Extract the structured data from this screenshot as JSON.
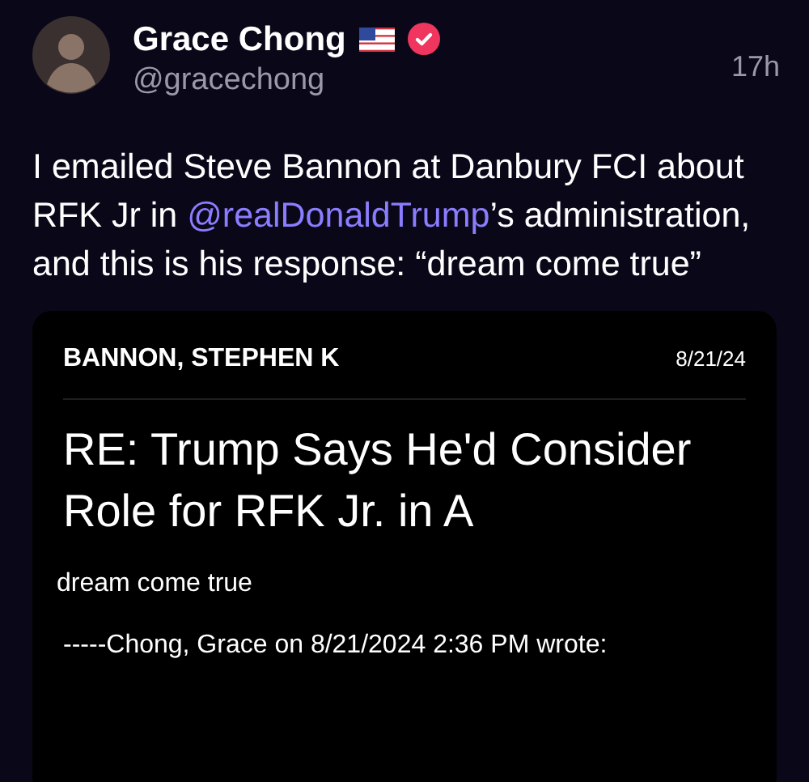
{
  "post": {
    "author": {
      "name": "Grace Chong",
      "handle": "@gracechong",
      "verified": true
    },
    "time": "17h",
    "text_before": "I emailed Steve Bannon at Danbury FCI about RFK Jr in ",
    "mention": "@realDonaldTrump",
    "text_after": "’s administration, and this is his response: “dream come true”",
    "email": {
      "sender": "BANNON, STEPHEN K",
      "date": "8/21/24",
      "subject": "RE: Trump Says He'd Consider Role for RFK Jr. in A",
      "body": "dream come true",
      "quote_header": "-----Chong, Grace on 8/21/2024 2:36 PM wrote:"
    }
  }
}
